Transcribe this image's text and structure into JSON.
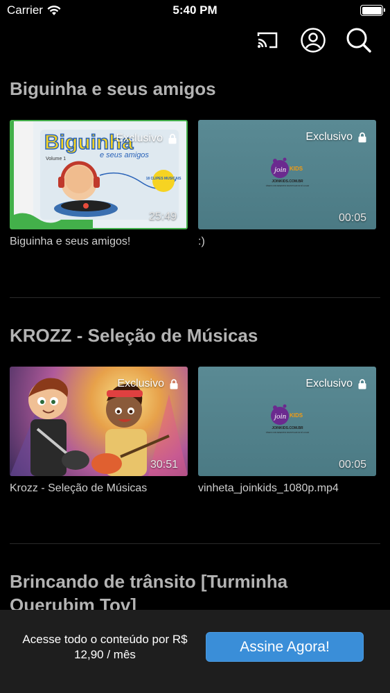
{
  "status_bar": {
    "carrier": "Carrier",
    "time": "5:40 PM",
    "battery_level": 1.0
  },
  "header": {
    "icons": [
      "cast-icon",
      "profile-icon",
      "search-icon"
    ]
  },
  "sections": [
    {
      "title": "Biguinha e seus amigos",
      "videos": [
        {
          "title": "Biguinha e seus amigos!",
          "badge": "Exclusivo",
          "duration": "25:49",
          "thumb_art": {
            "title": "Biguinha",
            "subtitle": "e seus amigos",
            "volume": "Volume 1",
            "sticker": "18 CLIPES MUSICAIS"
          }
        },
        {
          "title": ":)",
          "badge": "Exclusivo",
          "duration": "00:05",
          "thumb_art": {
            "brand": "join",
            "brand2": "KIDS",
            "url": "JOINKIDS.COM.BR",
            "tagline": "VÍDEOS COM DESENHOS INFANTIS EM UM SÓ LUGAR"
          }
        }
      ]
    },
    {
      "title": "KROZZ - Seleção de Músicas",
      "videos": [
        {
          "title": "Krozz - Seleção de Músicas",
          "badge": "Exclusivo",
          "duration": "30:51"
        },
        {
          "title": "vinheta_joinkids_1080p.mp4",
          "badge": "Exclusivo",
          "duration": "00:05",
          "thumb_art": {
            "brand": "join",
            "brand2": "KIDS",
            "url": "JOINKIDS.COM.BR",
            "tagline": "VÍDEOS COM DESENHOS INFANTIS EM UM SÓ LUGAR"
          }
        }
      ]
    },
    {
      "title": "Brincando de trânsito [Turminha Querubim Tov]"
    }
  ],
  "bottom_bar": {
    "promo_text": "Acesse todo o conteúdo por R$ 12,90 / mês",
    "subscribe_label": "Assine Agora!"
  },
  "colors": {
    "accent": "#3a8ed8",
    "background": "#000000",
    "section_title": "#b3b3b3"
  }
}
